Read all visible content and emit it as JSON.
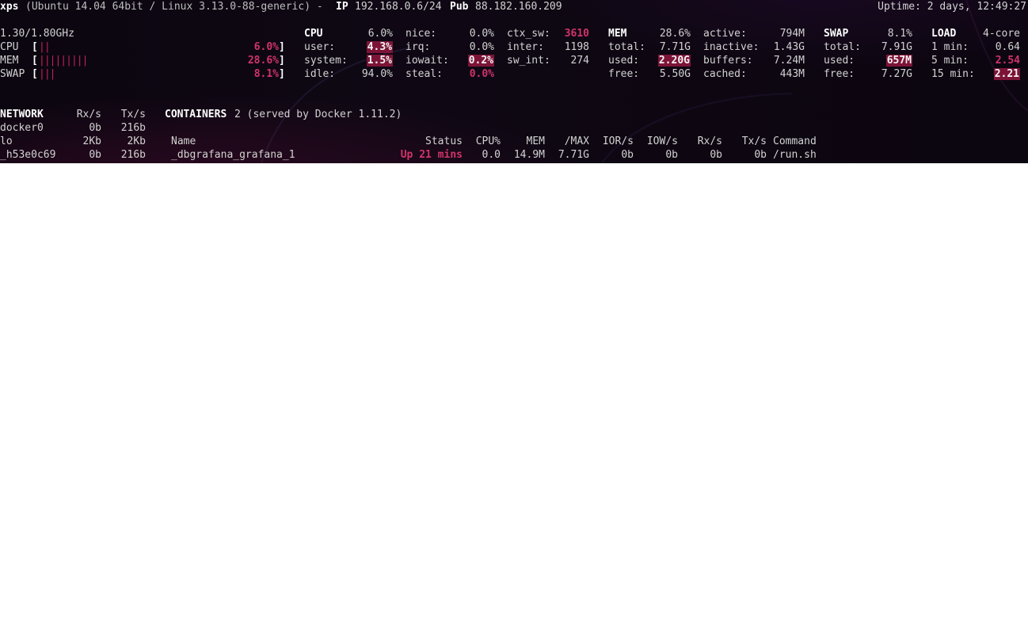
{
  "header": {
    "hostname": "xps",
    "os": "(Ubuntu 14.04 64bit / Linux 3.13.0-88-generic) -",
    "ip_label": "IP",
    "ip": "192.168.0.6/24",
    "pub_label": "Pub",
    "pub_ip": "88.182.160.209",
    "uptime": "Uptime: 2 days, 12:49:27"
  },
  "quicklook": {
    "freq": "1.30/1.80GHz",
    "rows": [
      {
        "label": "CPU",
        "open": "[",
        "bar": "||",
        "pct": "6.0%",
        "close": "]"
      },
      {
        "label": "MEM",
        "open": "[",
        "bar": "|||||||||",
        "pct": "28.6%",
        "close": "]"
      },
      {
        "label": "SWAP",
        "open": "[",
        "bar": "|||",
        "pct": "8.1%",
        "close": "]"
      }
    ]
  },
  "cpu": {
    "title": "CPU",
    "total": "6.0%",
    "user_label": "user:",
    "user": "4.3%",
    "system_label": "system:",
    "system": "1.5%",
    "idle_label": "idle:",
    "idle": "94.0%",
    "nice_label": "nice:",
    "nice": "0.0%",
    "irq_label": "irq:",
    "irq": "0.0%",
    "iowait_label": "iowait:",
    "iowait": "0.2%",
    "steal_label": "steal:",
    "steal": "0.0%",
    "ctx_sw_label": "ctx_sw:",
    "ctx_sw": "3610",
    "inter_label": "inter:",
    "inter": "1198",
    "sw_int_label": "sw_int:",
    "sw_int": "274"
  },
  "mem": {
    "title": "MEM",
    "pct": "28.6%",
    "total_label": "total:",
    "total": "7.71G",
    "used_label": "used:",
    "used": "2.20G",
    "free_label": "free:",
    "free": "5.50G",
    "active_label": "active:",
    "active": "794M",
    "inactive_label": "inactive:",
    "inactive": "1.43G",
    "buffers_label": "buffers:",
    "buffers": "7.24M",
    "cached_label": "cached:",
    "cached": "443M"
  },
  "swap": {
    "title": "SWAP",
    "pct": "8.1%",
    "total_label": "total:",
    "total": "7.91G",
    "used_label": "used:",
    "used": "657M",
    "free_label": "free:",
    "free": "7.27G"
  },
  "load": {
    "title": "LOAD",
    "cores": "4-core",
    "m1_label": "1 min:",
    "m1": "0.64",
    "m5_label": "5 min:",
    "m5": "2.54",
    "m15_label": "15 min:",
    "m15": "2.21"
  },
  "network": {
    "title": "NETWORK",
    "rx_header": "Rx/s",
    "tx_header": "Tx/s",
    "rows": [
      {
        "name": "docker0",
        "rx": "0b",
        "tx": "216b"
      },
      {
        "name": "lo",
        "rx": "2Kb",
        "tx": "2Kb"
      },
      {
        "name": "_h53e0c69",
        "rx": "0b",
        "tx": "216b"
      }
    ]
  },
  "containers": {
    "title": "CONTAINERS",
    "summary": "2 (served by Docker 1.11.2)",
    "headers": {
      "name": "Name",
      "status": "Status",
      "cpu": "CPU%",
      "mem": "MEM",
      "max": "/MAX",
      "ior": "IOR/s",
      "iow": "IOW/s",
      "rx": "Rx/s",
      "tx": "Tx/s",
      "command": "Command"
    },
    "rows": [
      {
        "name": "_dbgrafana_grafana_1",
        "status": "Up 21 mins",
        "cpu": "0.0",
        "mem": "14.9M",
        "max": "7.71G",
        "ior": "0b",
        "iow": "0b",
        "rx": "0b",
        "tx": "0b",
        "command": "/run.sh"
      }
    ]
  },
  "colors": {
    "critical": "#d2336a",
    "highlight_bg": "#7d1437",
    "terminal_bg": "#0d0711"
  }
}
